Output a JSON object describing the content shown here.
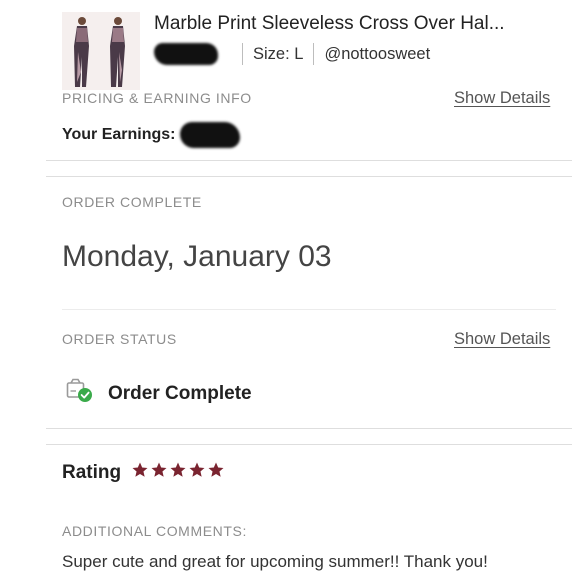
{
  "product": {
    "title": "Marble Print Sleeveless Cross Over Hal...",
    "size": "Size: L",
    "seller": "@nottoosweet"
  },
  "pricing": {
    "section_label": "PRICING & EARNING INFO",
    "show_details": "Show Details",
    "earnings_label": "Your Earnings:"
  },
  "order_complete": {
    "section_label": "ORDER COMPLETE",
    "date": "Monday, January 03"
  },
  "order_status": {
    "section_label": "ORDER STATUS",
    "show_details": "Show Details",
    "status": "Order Complete"
  },
  "rating": {
    "label": "Rating",
    "stars": 5,
    "max_stars": 5,
    "star_color": "#7a2430"
  },
  "comments": {
    "section_label": "ADDITIONAL COMMENTS:",
    "text": "Super cute and great for upcoming summer!! Thank you!"
  },
  "colors": {
    "check_green": "#3aaa4a",
    "label_gray": "#8c8c8c"
  }
}
